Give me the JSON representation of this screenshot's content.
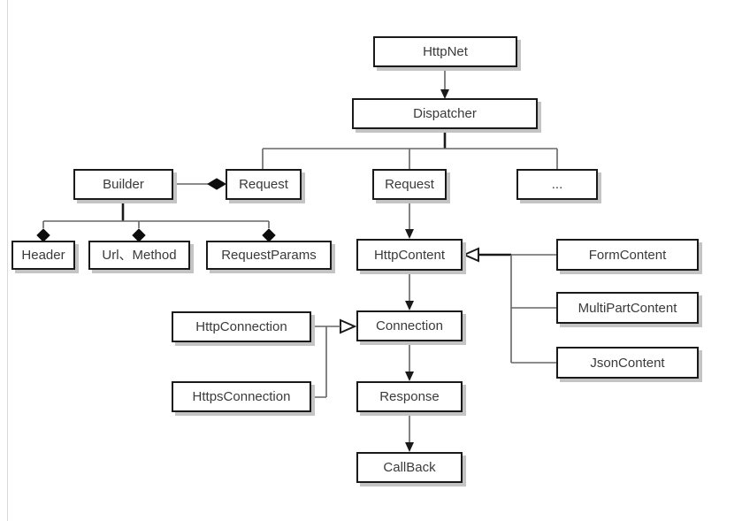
{
  "diagram": {
    "title": "HttpNet architecture class diagram",
    "background": "#ffffff",
    "node_border_color": "#1a1a1a",
    "node_shadow_color": "#c4c4c4",
    "line_color": "#666666",
    "text_color": "#3a3a3a"
  },
  "nodes": {
    "http_net": "HttpNet",
    "dispatcher": "Dispatcher",
    "builder": "Builder",
    "request_left": "Request",
    "request_mid": "Request",
    "ellipsis": "...",
    "header": "Header",
    "url_method": "Url、Method",
    "request_params": "RequestParams",
    "http_content": "HttpContent",
    "form_content": "FormContent",
    "multipart_content": "MultiPartContent",
    "json_content": "JsonContent",
    "http_connection": "HttpConnection",
    "https_connection": "HttpsConnection",
    "connection": "Connection",
    "response": "Response",
    "callback": "CallBack"
  },
  "edges": [
    {
      "from": "HttpNet",
      "to": "Dispatcher",
      "type": "arrow"
    },
    {
      "from": "Dispatcher",
      "to": "Request",
      "type": "plain"
    },
    {
      "from": "Dispatcher",
      "to": "Request",
      "type": "plain"
    },
    {
      "from": "Dispatcher",
      "to": "...",
      "type": "plain"
    },
    {
      "from": "Builder",
      "to": "Request",
      "type": "composition-diamond"
    },
    {
      "from": "Builder",
      "to": "Header",
      "type": "composition-diamond"
    },
    {
      "from": "Builder",
      "to": "Url、Method",
      "type": "composition-diamond"
    },
    {
      "from": "Builder",
      "to": "RequestParams",
      "type": "composition-diamond"
    },
    {
      "from": "Request",
      "to": "HttpContent",
      "type": "arrow"
    },
    {
      "from": "FormContent",
      "to": "HttpContent",
      "type": "generalization"
    },
    {
      "from": "MultiPartContent",
      "to": "HttpContent",
      "type": "generalization"
    },
    {
      "from": "JsonContent",
      "to": "HttpContent",
      "type": "generalization"
    },
    {
      "from": "HttpContent",
      "to": "Connection",
      "type": "arrow"
    },
    {
      "from": "HttpConnection",
      "to": "Connection",
      "type": "generalization"
    },
    {
      "from": "HttpsConnection",
      "to": "Connection",
      "type": "generalization"
    },
    {
      "from": "Connection",
      "to": "Response",
      "type": "arrow"
    },
    {
      "from": "Response",
      "to": "CallBack",
      "type": "arrow"
    }
  ]
}
